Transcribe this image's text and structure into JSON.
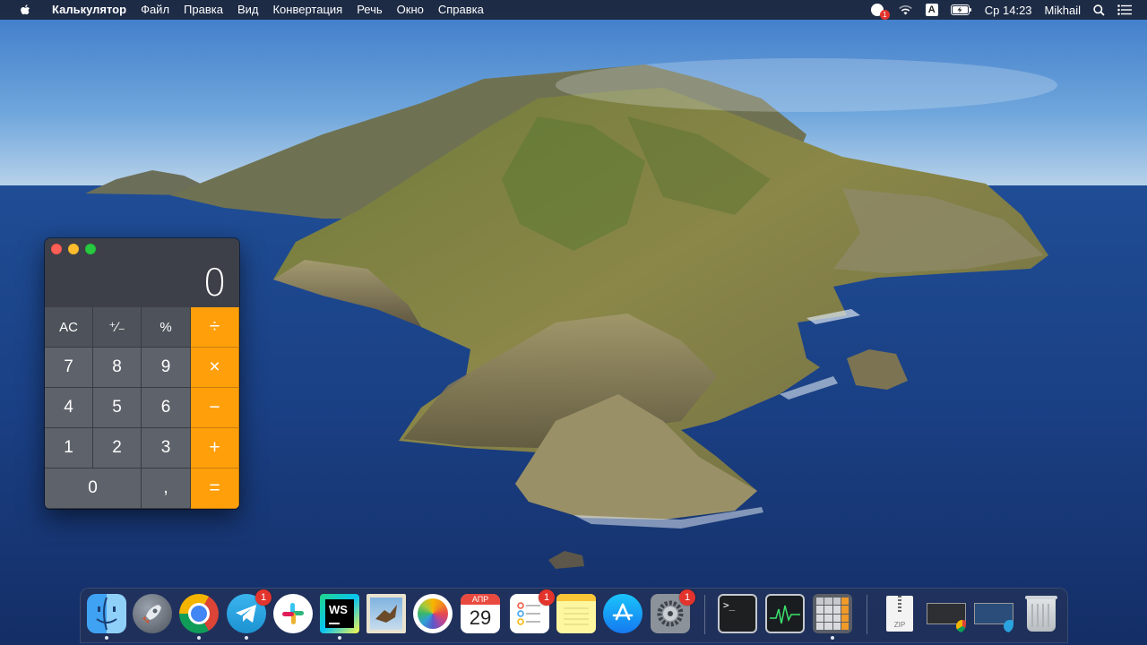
{
  "menubar": {
    "apple_icon": "apple-logo-icon",
    "app_name": "Калькулятор",
    "menus": [
      "Файл",
      "Правка",
      "Вид",
      "Конвертация",
      "Речь",
      "Окно",
      "Справка"
    ],
    "status": {
      "notification_badge": "1",
      "keyboard_layout": "A",
      "clock": "Ср 14:23",
      "user": "Mikhail"
    }
  },
  "calculator": {
    "display_value": "0",
    "keys": [
      {
        "label": "AC",
        "kind": "fn"
      },
      {
        "label": "⁺∕₋",
        "kind": "fn"
      },
      {
        "label": "%",
        "kind": "fn"
      },
      {
        "label": "÷",
        "kind": "op"
      },
      {
        "label": "7",
        "kind": "num"
      },
      {
        "label": "8",
        "kind": "num"
      },
      {
        "label": "9",
        "kind": "num"
      },
      {
        "label": "×",
        "kind": "op"
      },
      {
        "label": "4",
        "kind": "num"
      },
      {
        "label": "5",
        "kind": "num"
      },
      {
        "label": "6",
        "kind": "num"
      },
      {
        "label": "−",
        "kind": "op"
      },
      {
        "label": "1",
        "kind": "num"
      },
      {
        "label": "2",
        "kind": "num"
      },
      {
        "label": "3",
        "kind": "num"
      },
      {
        "label": "+",
        "kind": "op"
      },
      {
        "label": "0",
        "kind": "zero"
      },
      {
        "label": ",",
        "kind": "num"
      },
      {
        "label": "=",
        "kind": "op"
      }
    ]
  },
  "dock": {
    "calendar": {
      "month": "АПР",
      "day": "29"
    },
    "telegram_badge": "1",
    "reminders_badge": "1",
    "system_preferences_badge": "1",
    "terminal_prompt": ">_",
    "zip_label": "ZIP"
  },
  "colors": {
    "operator_key": "#ff9f0a",
    "badge_red": "#e2342c",
    "calculator_body": "#3d4049"
  }
}
